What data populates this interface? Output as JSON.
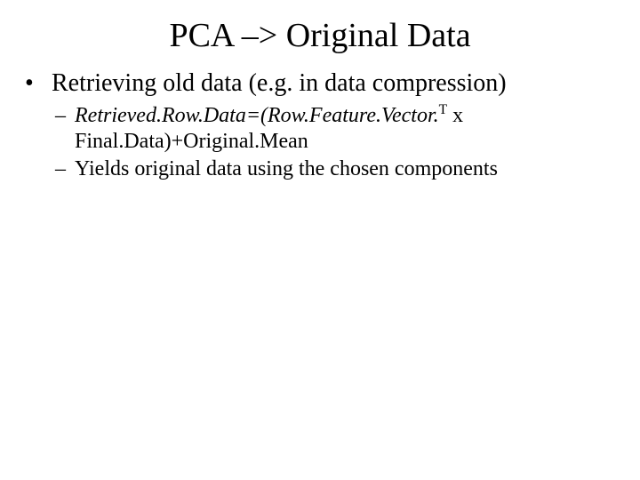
{
  "title": "PCA –> Original Data",
  "bullets": [
    {
      "text": "Retrieving old data (e.g. in data compression)"
    }
  ],
  "subs": [
    {
      "formula_part1": "Retrieved.Row.Data=(Row.Feature.Vector.",
      "formula_sup": "T",
      "formula_part2": " x Final.Data)+Original.Mean"
    },
    {
      "text": "Yields original data using the chosen components"
    }
  ]
}
